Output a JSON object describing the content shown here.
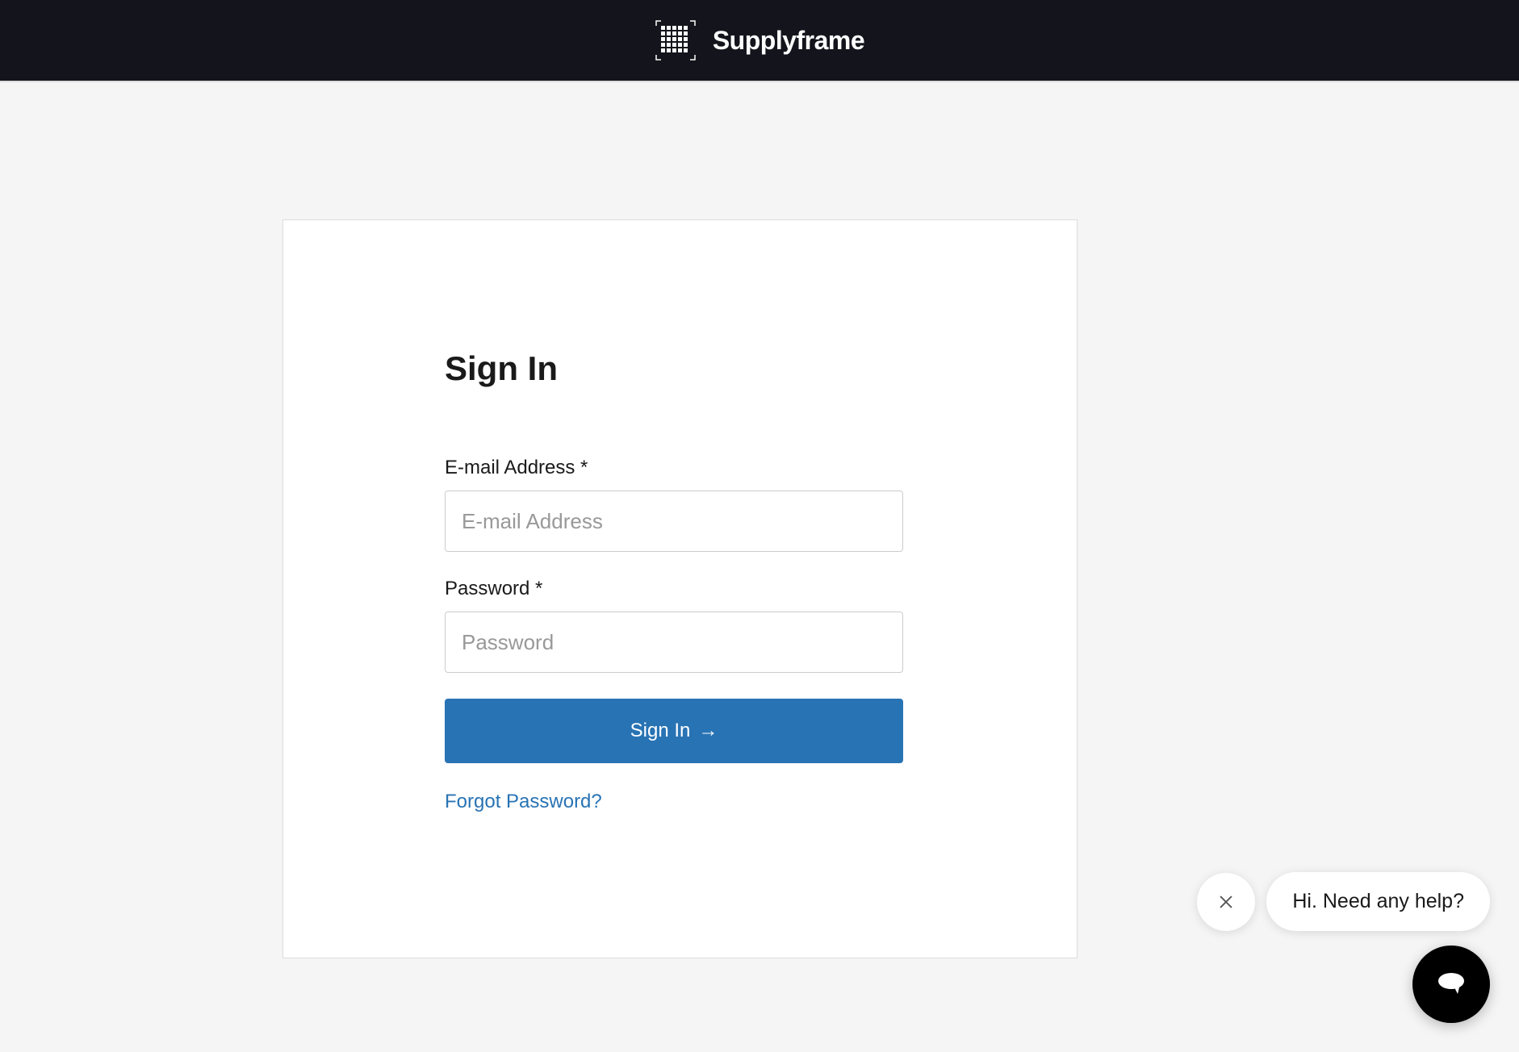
{
  "header": {
    "brand_name": "Supplyframe"
  },
  "signin": {
    "title": "Sign In",
    "email_label": "E-mail Address *",
    "email_placeholder": "E-mail Address",
    "email_value": "",
    "password_label": "Password *",
    "password_placeholder": "Password",
    "password_value": "",
    "button_label": "Sign In",
    "forgot_link": "Forgot Password?"
  },
  "chat": {
    "message": "Hi. Need any help?"
  }
}
